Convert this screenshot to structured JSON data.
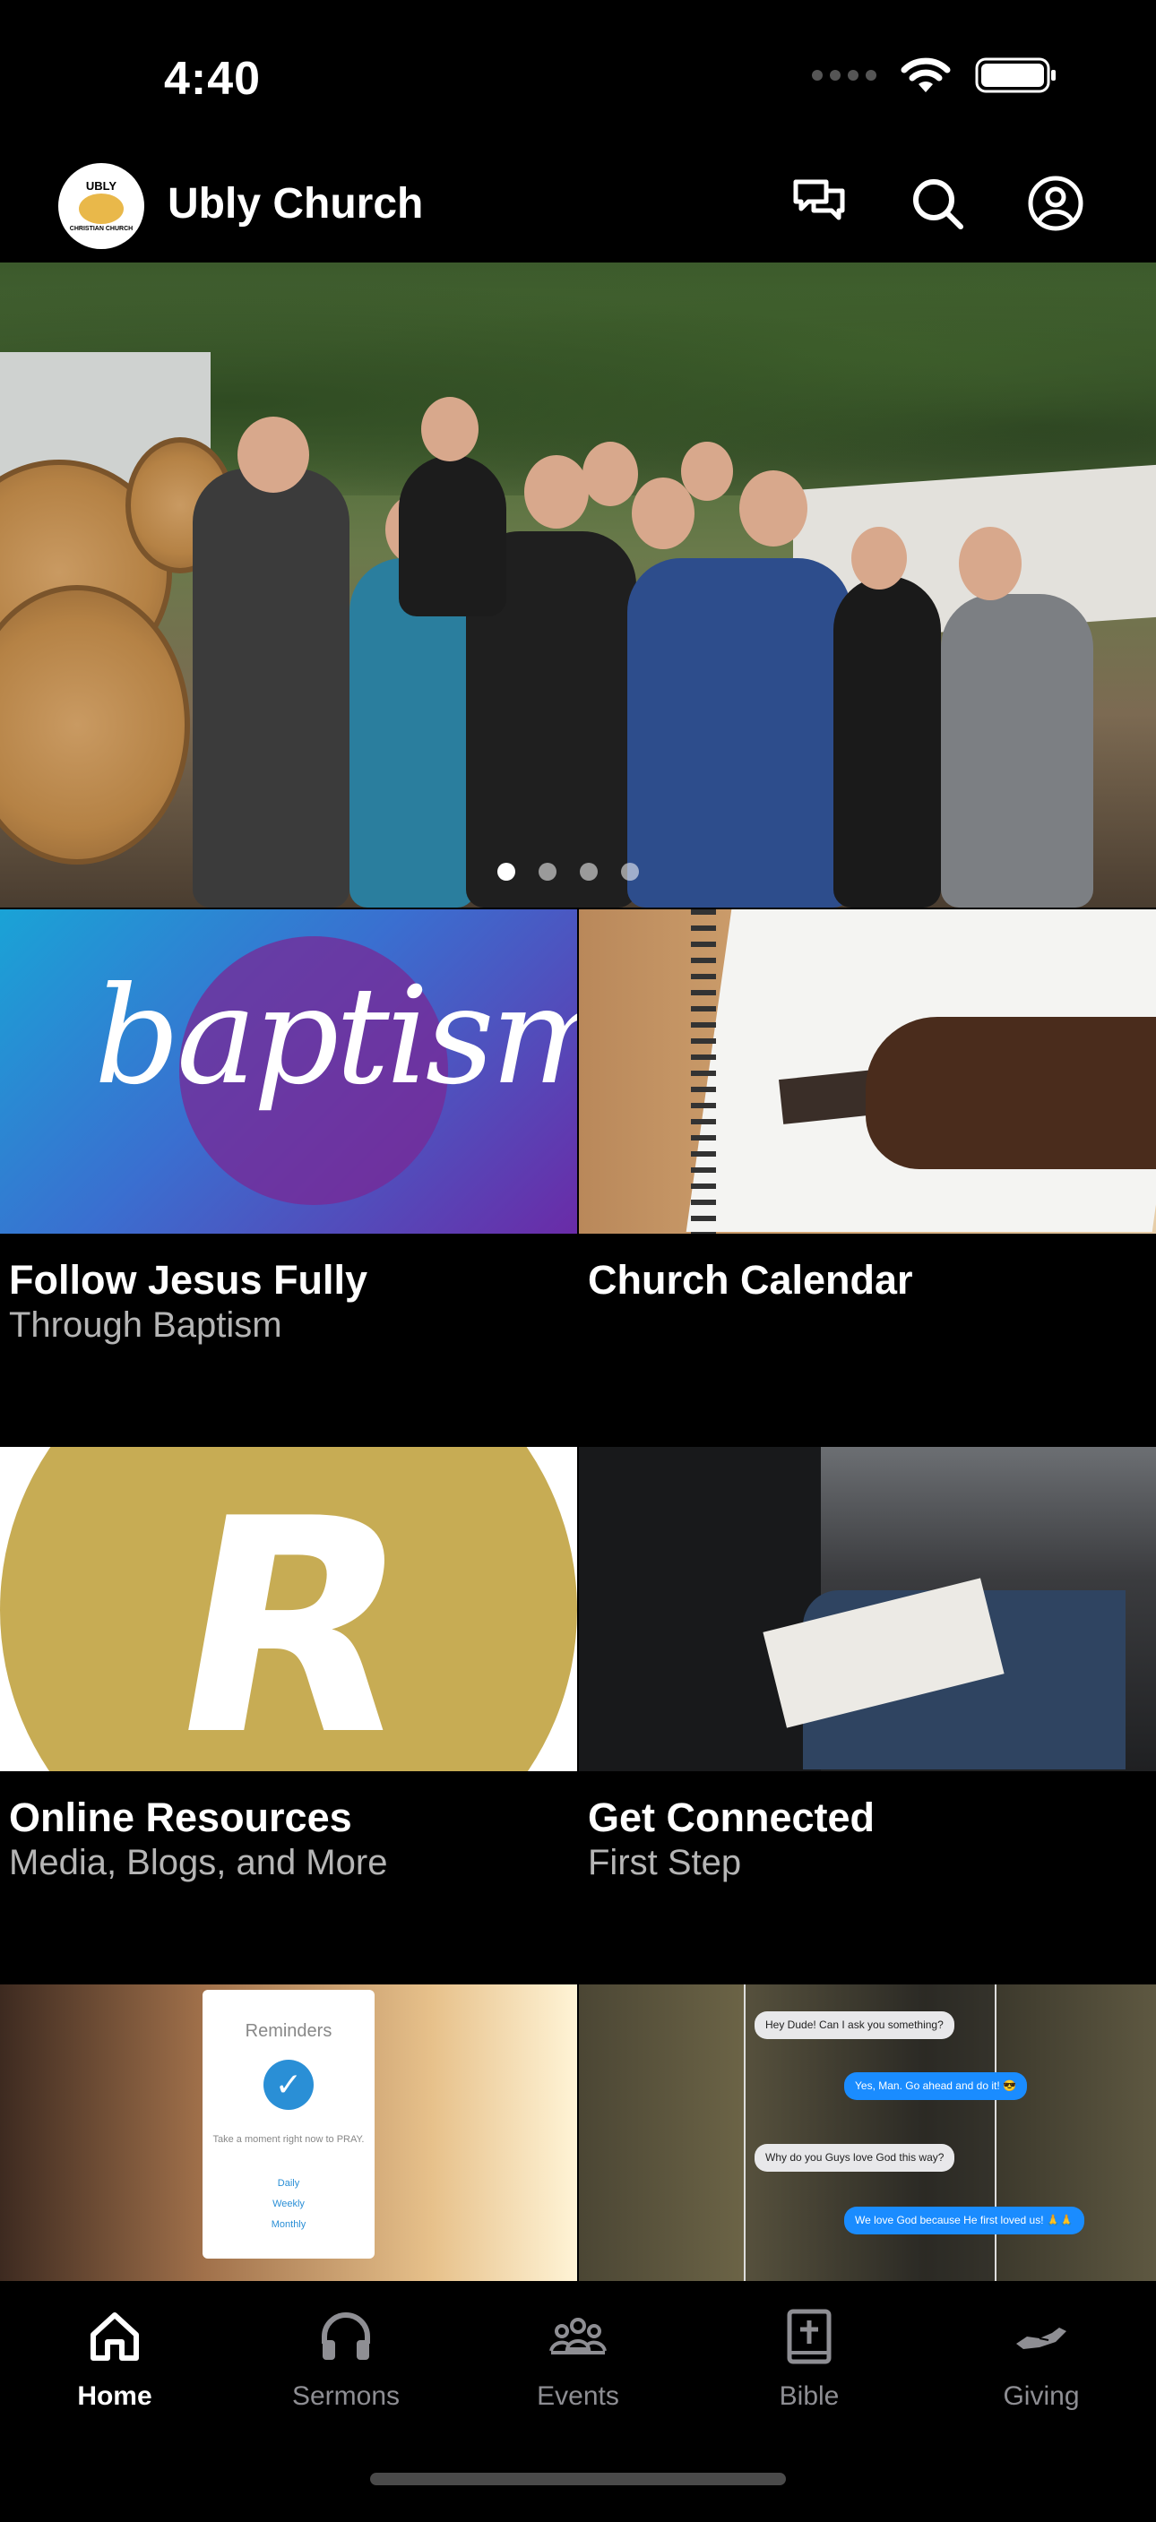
{
  "status_bar": {
    "time": "4:40"
  },
  "header": {
    "logo_text_top": "UBLY",
    "logo_text_bottom": "CHRISTIAN CHURCH",
    "title": "Ubly Church"
  },
  "carousel": {
    "dot_count": 4,
    "active_index": 0
  },
  "tiles": [
    {
      "title": "Follow Jesus Fully",
      "subtitle": "Through Baptism",
      "image_text": "baptism"
    },
    {
      "title": "Church Calendar",
      "subtitle": ""
    },
    {
      "title": "Online Resources",
      "subtitle": "Media, Blogs, and More",
      "image_text": "R"
    },
    {
      "title": "Get Connected",
      "subtitle": "First Step"
    },
    {
      "title": "",
      "subtitle": "",
      "image_text": "Reminders",
      "card_note": "Take a moment right now to PRAY.",
      "card_options": [
        "Daily",
        "Weekly",
        "Monthly"
      ]
    },
    {
      "title": "",
      "subtitle": "",
      "chat": [
        "Hey Dude! Can I ask you something?",
        "Yes, Man. Go ahead and do it! 😎",
        "Why do you Guys love God this way?",
        "We love God because He first loved us! 🙏🙏"
      ]
    }
  ],
  "tab_bar": {
    "items": [
      {
        "label": "Home",
        "icon": "home-icon",
        "active": true
      },
      {
        "label": "Sermons",
        "icon": "headphones-icon",
        "active": false
      },
      {
        "label": "Events",
        "icon": "group-icon",
        "active": false
      },
      {
        "label": "Bible",
        "icon": "bible-icon",
        "active": false
      },
      {
        "label": "Giving",
        "icon": "giving-icon",
        "active": false
      }
    ]
  },
  "colors": {
    "background": "#000000",
    "active_tab": "#ffffff",
    "inactive_tab": "#8e8e93",
    "subtitle": "#b5b5b5"
  }
}
